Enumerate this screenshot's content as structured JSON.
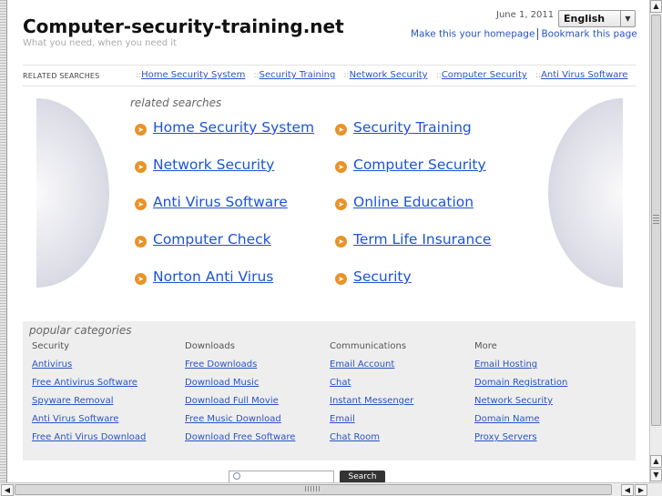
{
  "header": {
    "site_title": "Computer-security-training.net",
    "tagline": "What you need, when you need it",
    "date": "June 1, 2011",
    "language": "English",
    "make_homepage": "Make this your homepage",
    "bookmark": "Bookmark this page"
  },
  "related_bar": {
    "label": "RELATED SEARCHES",
    "links": [
      "Home Security System",
      "Security Training",
      "Network Security",
      "Computer Security",
      "Anti Virus Software"
    ]
  },
  "related": {
    "title": "related searches",
    "left": [
      "Home Security System",
      "Network Security",
      "Anti Virus Software",
      "Computer Check",
      "Norton Anti Virus"
    ],
    "right": [
      "Security Training",
      "Computer Security",
      "Online Education",
      "Term Life Insurance",
      "Security"
    ]
  },
  "popular": {
    "title": "popular categories",
    "columns": [
      {
        "head": "Security",
        "links": [
          "Antivirus",
          "Free Antivirus Software",
          "Spyware Removal",
          "Anti Virus Software",
          "Free Anti Virus Download"
        ]
      },
      {
        "head": "Downloads",
        "links": [
          "Free Downloads",
          "Download Music",
          "Download Full Movie",
          "Free Music Download",
          "Download Free Software"
        ]
      },
      {
        "head": "Communications",
        "links": [
          "Email Account",
          "Chat",
          "Instant Messenger",
          "Email",
          "Chat Room"
        ]
      },
      {
        "head": "More",
        "links": [
          "Email Hosting",
          "Domain Registration",
          "Network Security",
          "Domain Name",
          "Proxy Servers"
        ]
      }
    ]
  },
  "search": {
    "button": "Search",
    "icon": "magnifier-icon"
  },
  "colors": {
    "link": "#1c54d6",
    "bullet": "#e8932a",
    "popular_bg": "#eeeeee"
  }
}
